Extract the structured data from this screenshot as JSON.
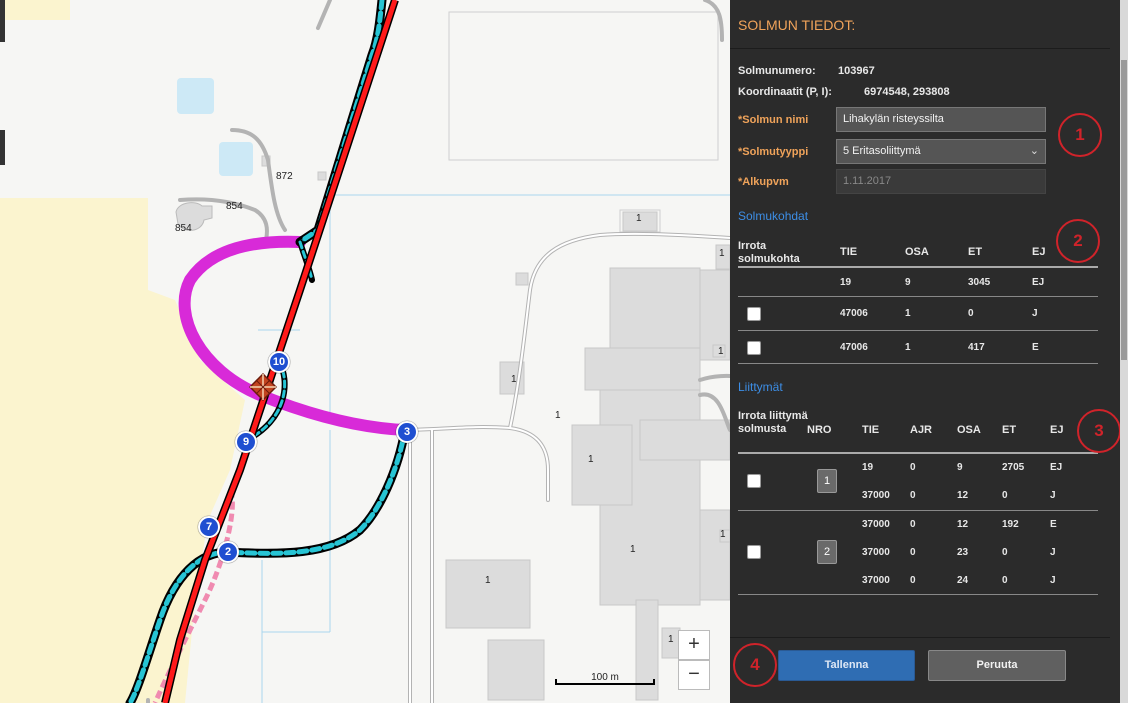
{
  "map": {
    "labels": {
      "l872": "872",
      "l854a": "854",
      "l854b": "854",
      "b1a": "1",
      "b1b": "1",
      "b1c": "1",
      "b1d": "1",
      "b1e": "1",
      "b1f": "1",
      "b1g": "1",
      "b1h": "1",
      "b1i": "1",
      "b1j": "1"
    },
    "markers": {
      "m10": "10",
      "m9": "9",
      "m3": "3",
      "m7": "7",
      "m2": "2"
    },
    "zoom_in": "+",
    "zoom_out": "−",
    "scale": "100 m"
  },
  "panel": {
    "title": "SOLMUN TIEDOT:",
    "node_number_label": "Solmunumero:",
    "node_number": "103967",
    "coords_label": "Koordinaatit (P, I):",
    "coords": "6974548, 293808",
    "name_label": "*Solmun nimi",
    "name_value": "Lihakylän risteyssilta",
    "type_label": "*Solmutyyppi",
    "type_value": "5 Eritasoliittymä",
    "start_label": "*Alkupvm",
    "start_value": "1.11.2017",
    "section1": "Solmukohdat",
    "t1_headers": {
      "detach": "Irrota solmukohta",
      "tie": "TIE",
      "osa": "OSA",
      "et": "ET",
      "ej": "EJ"
    },
    "t1_rows": [
      {
        "tie": "19",
        "osa": "9",
        "et": "3045",
        "ej": "EJ"
      },
      {
        "tie": "47006",
        "osa": "1",
        "et": "0",
        "ej": "J"
      },
      {
        "tie": "47006",
        "osa": "1",
        "et": "417",
        "ej": "E"
      }
    ],
    "section2": "Liittymät",
    "t2_headers": {
      "detach": "Irrota liittymä solmusta",
      "nro": "NRO",
      "tie": "TIE",
      "ajr": "AJR",
      "osa": "OSA",
      "et": "ET",
      "ej": "EJ"
    },
    "t2_groups": [
      {
        "nro": "1",
        "rows": [
          {
            "tie": "19",
            "ajr": "0",
            "osa": "9",
            "et": "2705",
            "ej": "EJ"
          },
          {
            "tie": "37000",
            "ajr": "0",
            "osa": "12",
            "et": "0",
            "ej": "J"
          }
        ]
      },
      {
        "nro": "2",
        "rows": [
          {
            "tie": "37000",
            "ajr": "0",
            "osa": "12",
            "et": "192",
            "ej": "E"
          },
          {
            "tie": "37000",
            "ajr": "0",
            "osa": "23",
            "et": "0",
            "ej": "J"
          },
          {
            "tie": "37000",
            "ajr": "0",
            "osa": "24",
            "et": "0",
            "ej": "J"
          }
        ]
      }
    ],
    "annotations": {
      "a1": "1",
      "a2": "2",
      "a3": "3",
      "a4": "4"
    },
    "save_label": "Tallenna",
    "cancel_label": "Peruuta"
  },
  "colors": {
    "accent_orange": "#f0a35a",
    "section_blue": "#3d8ee6",
    "road_red": "#ff1a1a",
    "ramp_magenta": "#d82ad8",
    "annotation_red": "#d0232a"
  }
}
